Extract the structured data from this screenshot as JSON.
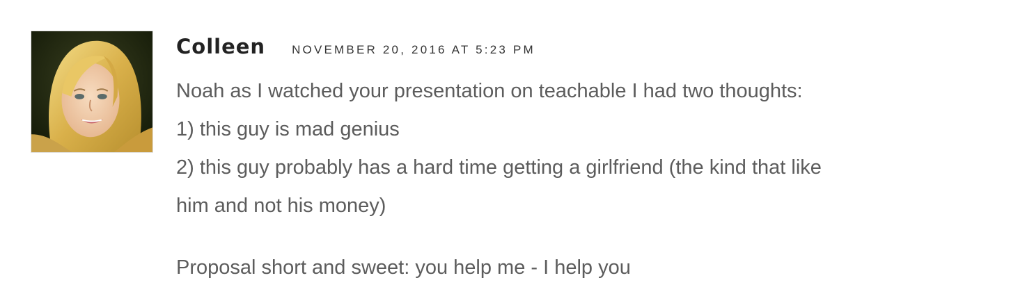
{
  "comment": {
    "author": "Colleen",
    "date": "NOVEMBER 20, 2016 AT 5:23 PM",
    "avatar_icon": "user-photo",
    "paragraphs": [
      {
        "lines": [
          "Noah as I watched your presentation on teachable I had two thoughts:",
          "1) this guy is mad genius",
          "2) this guy probably has a hard time getting a girlfriend (the kind that like",
          "him and not his money)"
        ]
      },
      {
        "lines": [
          "Proposal short and sweet: you help me - I help you"
        ]
      }
    ]
  },
  "colors": {
    "author": "#222222",
    "date": "#333333",
    "body_text": "#5c5c5c",
    "background": "#ffffff"
  }
}
